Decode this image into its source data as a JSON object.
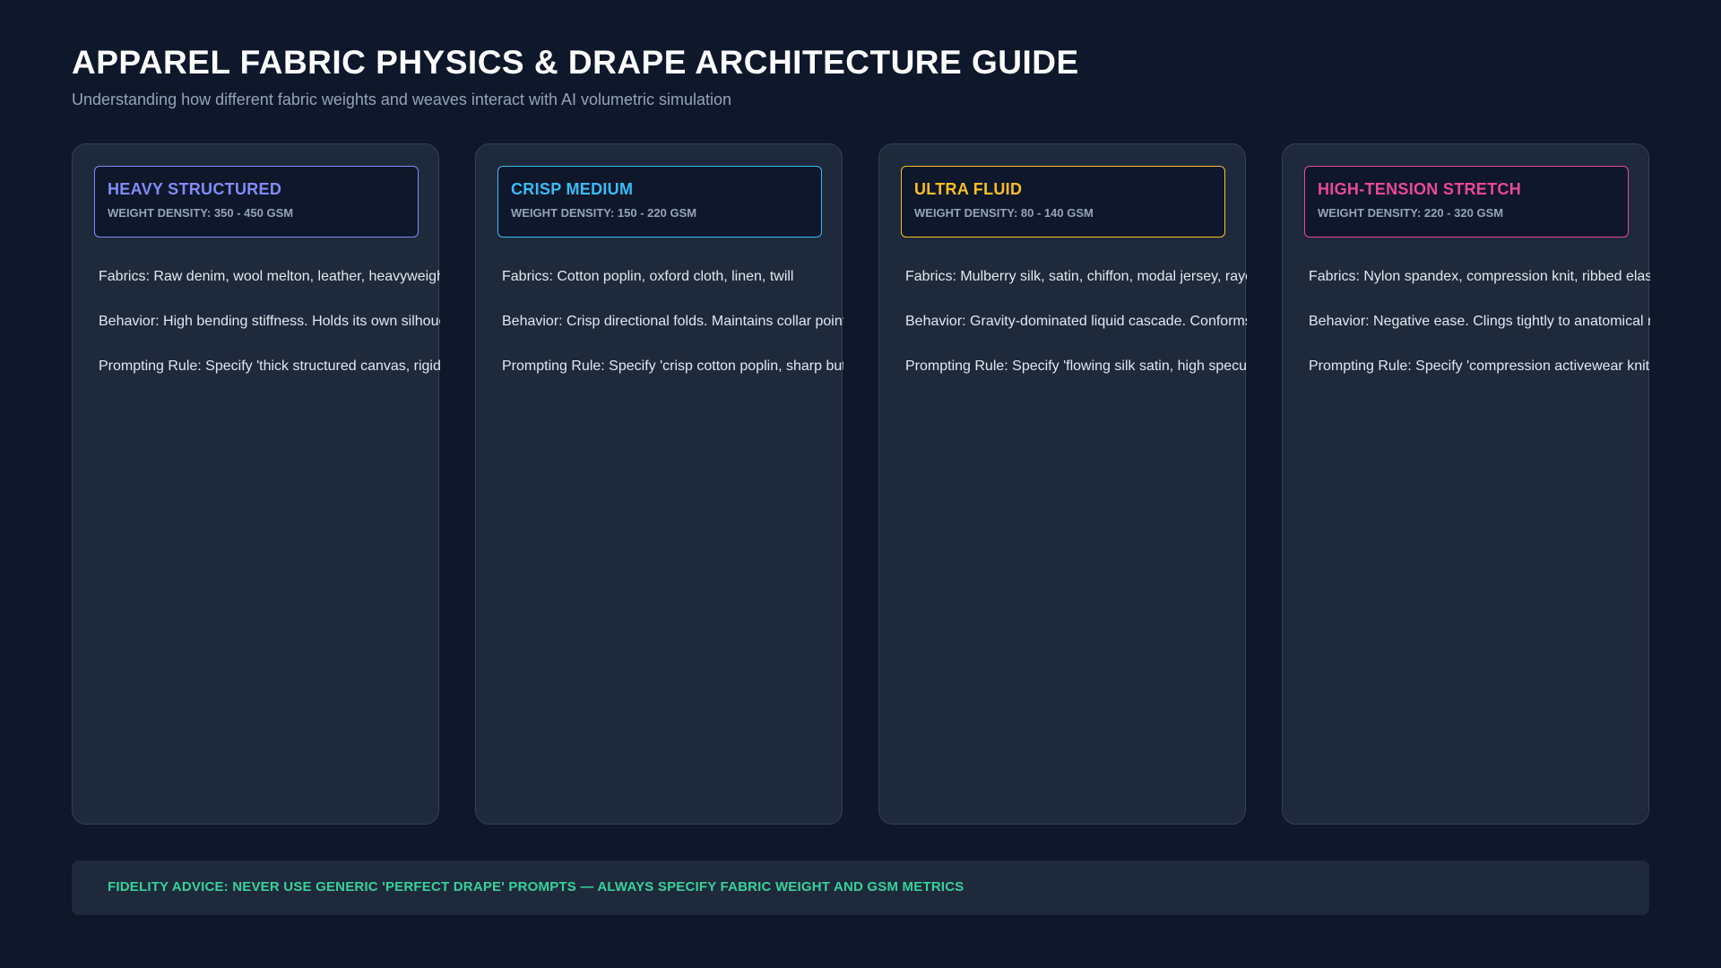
{
  "header": {
    "title": "APPAREL FABRIC PHYSICS & DRAPE ARCHITECTURE GUIDE",
    "subtitle": "Understanding how different fabric weights and weaves interact with AI volumetric simulation"
  },
  "cards": [
    {
      "name": "HEAVY STRUCTURED",
      "weight": "WEIGHT DENSITY: 350 - 450 GSM",
      "accent": "#818cf8",
      "fabrics": "Fabrics: Raw denim, wool melton, leather, heavyweight canvas",
      "behavior": "Behavior: High bending stiffness. Holds its own silhouette independent of the body.",
      "rule": "Prompting Rule: Specify 'thick structured canvas, rigid creases'"
    },
    {
      "name": "CRISP MEDIUM",
      "weight": "WEIGHT DENSITY: 150 - 220 GSM",
      "accent": "#38bdf8",
      "fabrics": "Fabrics: Cotton poplin, oxford cloth, linen, twill",
      "behavior": "Behavior: Crisp directional folds. Maintains collar point sharpness.",
      "rule": "Prompting Rule: Specify 'crisp cotton poplin, sharp button placket'"
    },
    {
      "name": "ULTRA FLUID",
      "weight": "WEIGHT DENSITY: 80 - 140 GSM",
      "accent": "#fbbf24",
      "fabrics": "Fabrics: Mulberry silk, satin, chiffon, modal jersey, rayon",
      "behavior": "Behavior: Gravity-dominated liquid cascade. Conforms dynamically to the body.",
      "rule": "Prompting Rule: Specify 'flowing silk satin, high specular sheen'"
    },
    {
      "name": "HIGH-TENSION STRETCH",
      "weight": "WEIGHT DENSITY: 220 - 320 GSM",
      "accent": "#ec4899",
      "fabrics": "Fabrics: Nylon spandex, compression knit, ribbed elastane",
      "behavior": "Behavior: Negative ease. Clings tightly to anatomical musculature.",
      "rule": "Prompting Rule: Specify 'compression activewear knit, matte aerodynamic finish'"
    }
  ],
  "footer": {
    "advice": "FIDELITY ADVICE: NEVER USE GENERIC 'PERFECT DRAPE' PROMPTS — ALWAYS SPECIFY FABRIC WEIGHT AND GSM METRICS"
  }
}
